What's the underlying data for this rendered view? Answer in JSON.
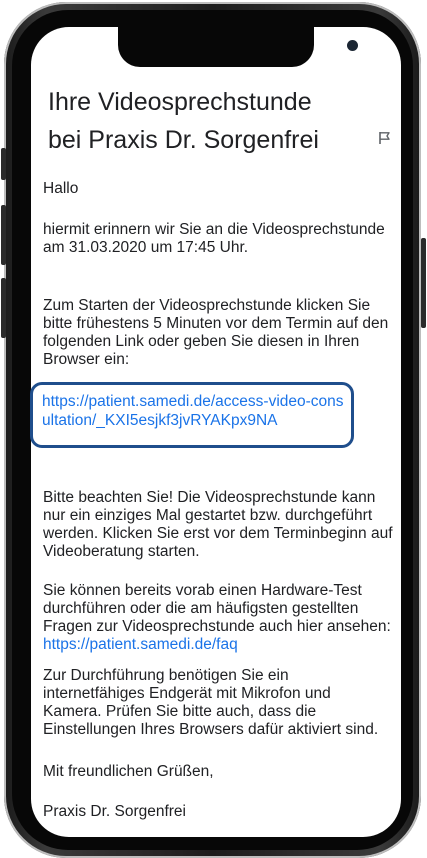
{
  "email": {
    "subject": "Ihre Videosprechstunde bei Praxis Dr. Sorgenfrei",
    "icons": {
      "flag": "flag-icon"
    },
    "greeting": "Hallo",
    "reminder": "hiermit erinnern wir Sie an die Videosprechstunde am 31.03.2020 um 17:45 Uhr.",
    "start_instructions": "Zum Starten der Videosprechstunde klicken Sie bitte frühestens 5 Minuten vor dem Termin auf den folgenden Link oder geben Sie diesen in Ihren Browser ein:",
    "access_link": "https://patient.samedi.de/access-video-consultation/_KXI5esjkf3jvRYAKpx9NA",
    "notice": "Bitte beachten Sie! Die Videosprechstunde kann nur ein einziges Mal gestartet bzw. durchgeführt werden. Klicken Sie erst vor dem Terminbeginn auf Videoberatung starten.",
    "faq_text": "Sie können bereits vorab einen Hardware-Test durchführen oder die am häufigsten gestellten Fragen zur Videosprechstunde auch hier ansehen: ",
    "faq_link": "https://patient.samedi.de/faq",
    "requirements": "Zur Durchführung benötigen Sie ein internetfähiges Endgerät mit Mikrofon und Kamera. Prüfen Sie bitte auch, dass die Einstellungen Ihres Browsers dafür aktiviert sind.",
    "closing": "Mit freundlichen Grüßen,",
    "signature": "Praxis Dr. Sorgenfrei"
  },
  "colors": {
    "link": "#1a73e8",
    "highlight_border": "#1f4e8c",
    "text": "#202124"
  }
}
